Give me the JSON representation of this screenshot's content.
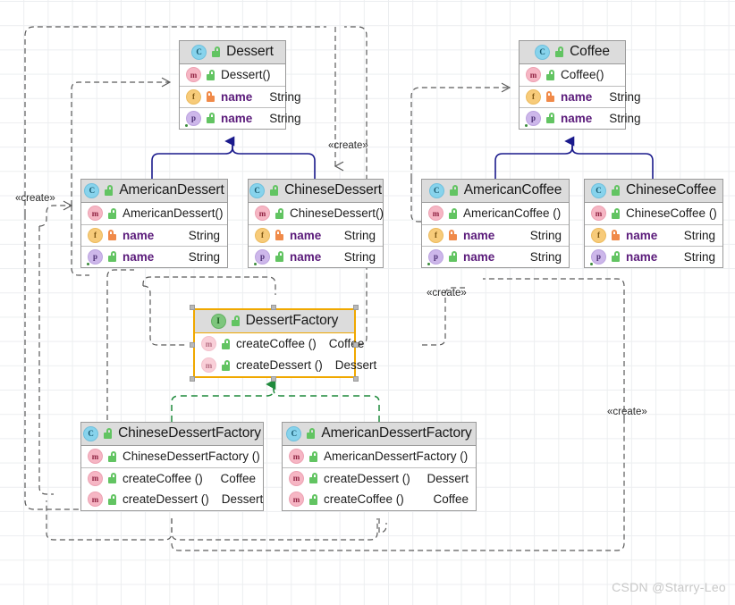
{
  "diagram": {
    "kind": "uml-class-diagram",
    "watermark": "CSDN @Starry-Leo",
    "colors": {
      "inheritance": "#1a1a8c",
      "realization": "#1f8a3c",
      "dependency": "#5a5a5a",
      "selection": "#f0a800",
      "header_fill": "#dcdcdc",
      "grid": "#eceef0"
    }
  },
  "classes": {
    "dessert": {
      "name": "Dessert",
      "kind_icon": "class-icon",
      "members": [
        {
          "icon": "method-icon",
          "vis": "public",
          "name": "Dessert()",
          "type": ""
        },
        {
          "icon": "field-icon",
          "vis": "private",
          "name": "name",
          "type": "String"
        },
        {
          "icon": "property-icon",
          "vis": "public",
          "name": "name",
          "type": "String"
        }
      ]
    },
    "coffee": {
      "name": "Coffee",
      "kind_icon": "class-icon",
      "members": [
        {
          "icon": "method-icon",
          "vis": "public",
          "name": "Coffee()",
          "type": ""
        },
        {
          "icon": "field-icon",
          "vis": "private",
          "name": "name",
          "type": "String"
        },
        {
          "icon": "property-icon",
          "vis": "public",
          "name": "name",
          "type": "String"
        }
      ]
    },
    "american_dessert": {
      "name": "AmericanDessert",
      "kind_icon": "class-icon",
      "members": [
        {
          "icon": "method-icon",
          "vis": "public",
          "name": "AmericanDessert()",
          "type": ""
        },
        {
          "icon": "field-icon",
          "vis": "private",
          "name": "name",
          "type": "String"
        },
        {
          "icon": "property-icon",
          "vis": "public",
          "name": "name",
          "type": "String"
        }
      ]
    },
    "chinese_dessert": {
      "name": "ChineseDessert",
      "kind_icon": "class-icon",
      "members": [
        {
          "icon": "method-icon",
          "vis": "public",
          "name": "ChineseDessert()",
          "type": ""
        },
        {
          "icon": "field-icon",
          "vis": "private",
          "name": "name",
          "type": "String"
        },
        {
          "icon": "property-icon",
          "vis": "public",
          "name": "name",
          "type": "String"
        }
      ]
    },
    "american_coffee": {
      "name": "AmericanCoffee",
      "kind_icon": "class-icon",
      "members": [
        {
          "icon": "method-icon",
          "vis": "public",
          "name": "AmericanCoffee ()",
          "type": ""
        },
        {
          "icon": "field-icon",
          "vis": "private",
          "name": "name",
          "type": "String"
        },
        {
          "icon": "property-icon",
          "vis": "public",
          "name": "name",
          "type": "String"
        }
      ]
    },
    "chinese_coffee": {
      "name": "ChineseCoffee",
      "kind_icon": "class-icon",
      "members": [
        {
          "icon": "method-icon",
          "vis": "public",
          "name": "ChineseCoffee ()",
          "type": ""
        },
        {
          "icon": "field-icon",
          "vis": "private",
          "name": "name",
          "type": "String"
        },
        {
          "icon": "property-icon",
          "vis": "public",
          "name": "name",
          "type": "String"
        }
      ]
    },
    "dessert_factory": {
      "name": "DessertFactory",
      "kind_icon": "interface-icon",
      "selected": "true",
      "members": [
        {
          "icon": "method-icon",
          "vis": "public",
          "name": "createCoffee ()",
          "type": "Coffee"
        },
        {
          "icon": "method-icon",
          "vis": "public",
          "name": "createDessert ()",
          "type": "Dessert"
        }
      ]
    },
    "chinese_dessert_factory": {
      "name": "ChineseDessertFactory",
      "kind_icon": "class-icon",
      "members": [
        {
          "icon": "method-icon",
          "vis": "public",
          "name": "ChineseDessertFactory ()",
          "type": ""
        },
        {
          "icon": "method-icon",
          "vis": "public",
          "name": "createCoffee ()",
          "type": "Coffee"
        },
        {
          "icon": "method-icon",
          "vis": "public",
          "name": "createDessert ()",
          "type": "Dessert"
        }
      ]
    },
    "american_dessert_factory": {
      "name": "AmericanDessertFactory",
      "kind_icon": "class-icon",
      "members": [
        {
          "icon": "method-icon",
          "vis": "public",
          "name": "AmericanDessertFactory ()",
          "type": ""
        },
        {
          "icon": "method-icon",
          "vis": "public",
          "name": "createDessert ()",
          "type": "Dessert"
        },
        {
          "icon": "method-icon",
          "vis": "public",
          "name": "createCoffee ()",
          "type": "Coffee"
        }
      ]
    }
  },
  "stereotypes": {
    "create_left": "«create»",
    "create_top": "«create»",
    "create_mid": "«create»",
    "create_right": "«create»"
  }
}
